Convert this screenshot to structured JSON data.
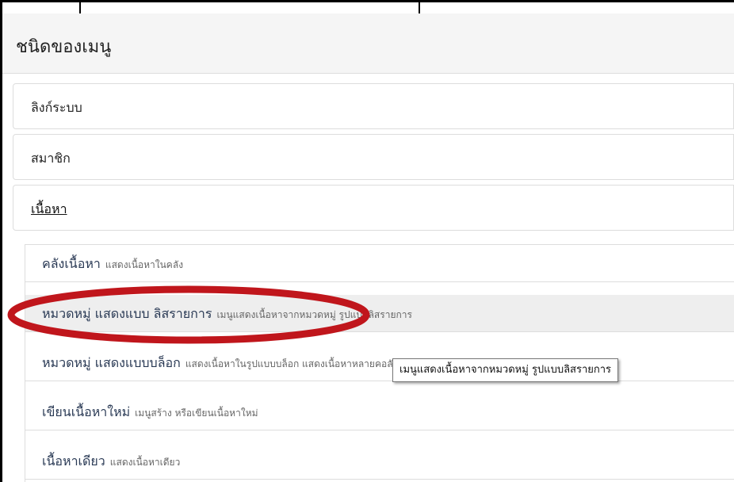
{
  "panel": {
    "title": "ชนิดของเมนู"
  },
  "categories": [
    {
      "label": "ลิงก์ระบบ",
      "expanded": false
    },
    {
      "label": "สมาชิก",
      "expanded": false
    },
    {
      "label": "เนื้อหา",
      "expanded": true
    }
  ],
  "content_items": [
    {
      "name": "คลังเนื้อหา",
      "description": "แสดงเนื้อหาในคลัง"
    },
    {
      "name": "หมวดหมู่ แสดงแบบ ลิสรายการ",
      "description": "เมนูแสดงเนื้อหาจากหมวดหมู่ รูปแบบลิสรายการ"
    },
    {
      "name": "หมวดหมู่ แสดงแบบบล็อก",
      "description": "แสดงเนื้อหาในรูปแบบบล็อก แสดงเนื้อหาหลายคอลัมน์"
    },
    {
      "name": "เขียนเนื้อหาใหม่",
      "description": "เมนูสร้าง หรือเขียนเนื้อหาใหม่"
    },
    {
      "name": "เนื้อหาเดียว",
      "description": "แสดงเนื้อหาเดียว"
    }
  ],
  "tooltip": {
    "text": "เมนูแสดงเนื้อหาจากหมวดหมู่ รูปแบบลิสรายการ"
  },
  "annotation": {
    "shape": "ellipse",
    "color": "#c0161c"
  },
  "colors": {
    "header_bg": "#f5f5f5",
    "border": "#dddddd",
    "item_text": "#2a3a55",
    "hover_bg": "#eeeeee"
  }
}
